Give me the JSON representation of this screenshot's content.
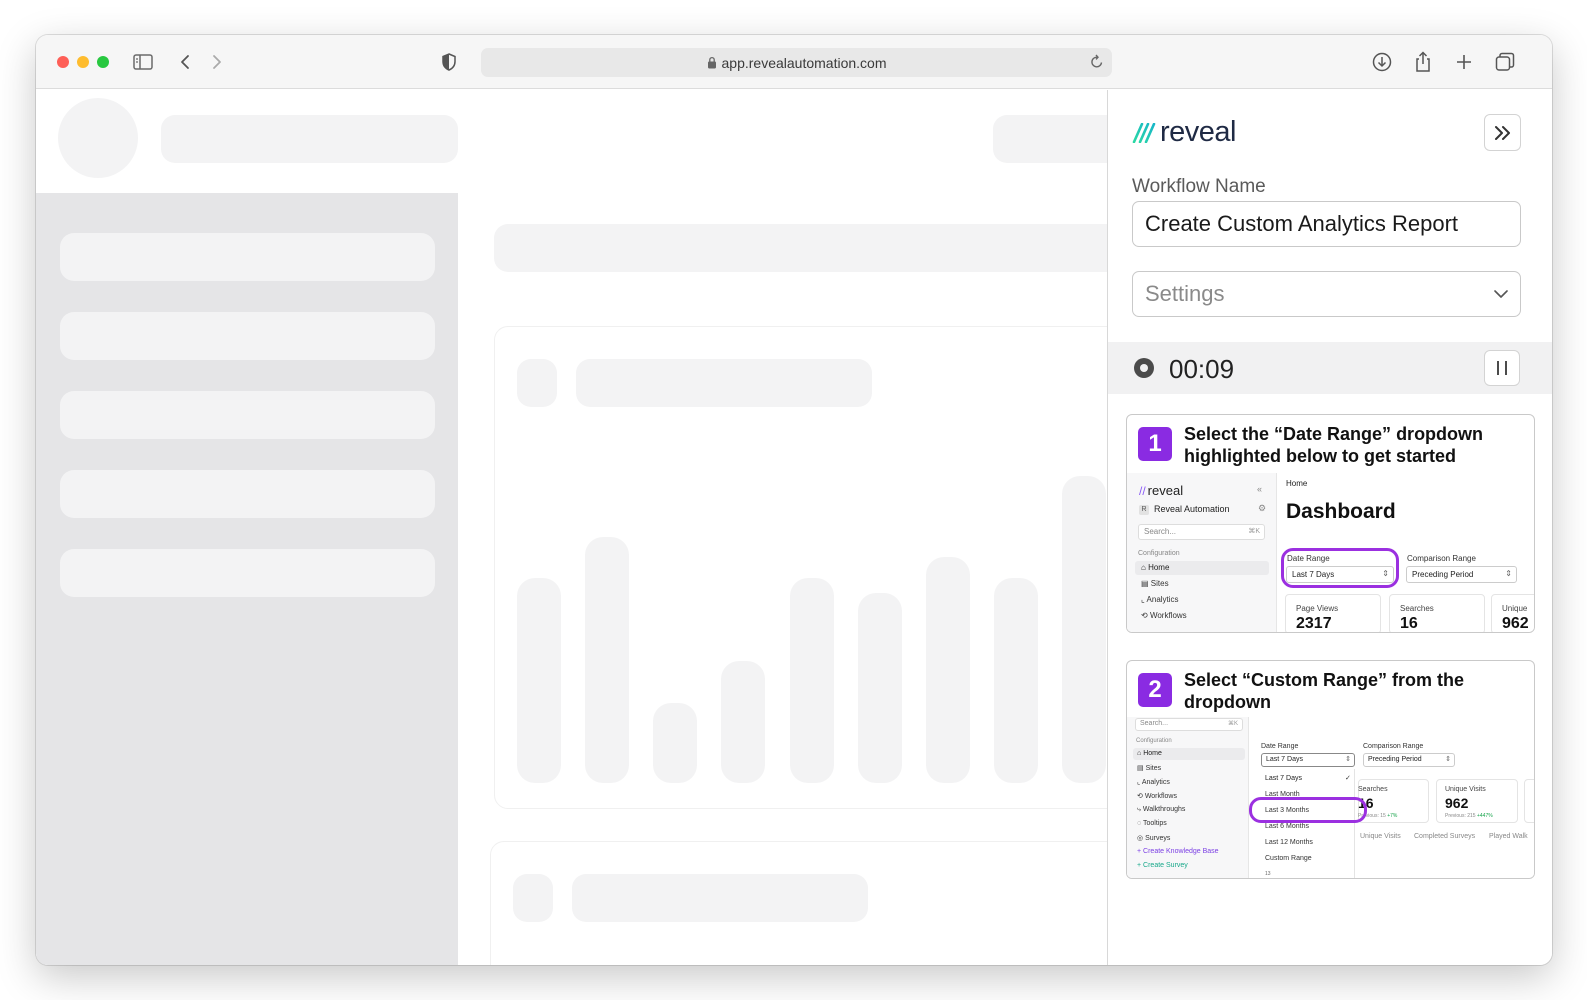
{
  "browser": {
    "url": "app.revealautomation.com"
  },
  "panel": {
    "brand": "reveal",
    "workflow_label": "Workflow Name",
    "workflow_name": "Create Custom Analytics Report",
    "settings_label": "Settings",
    "timer": "00:09",
    "steps": [
      {
        "number": "1",
        "title": "Select the “Date Range” dropdown highlighted below to get started",
        "shot": {
          "brand": "reveal",
          "org": "Reveal Automation",
          "org_initial": "R",
          "search_placeholder": "Search...",
          "search_shortcut": "⌘K",
          "section": "Configuration",
          "nav": [
            "Home",
            "Sites",
            "Analytics",
            "Workflows"
          ],
          "breadcrumb": "Home",
          "heading": "Dashboard",
          "date_range_label": "Date Range",
          "date_range_value": "Last 7 Days",
          "comparison_label": "Comparison Range",
          "comparison_value": "Preceding Period",
          "stats": [
            {
              "label": "Page Views",
              "value": "2317"
            },
            {
              "label": "Searches",
              "value": "16"
            },
            {
              "label": "Unique",
              "value": "962"
            }
          ]
        }
      },
      {
        "number": "2",
        "title": "Select “Custom Range” from the dropdown",
        "shot": {
          "search_placeholder": "Search...",
          "search_shortcut": "⌘K",
          "section": "Configuration",
          "nav": [
            "Home",
            "Sites",
            "Analytics",
            "Workflows",
            "Walkthroughs",
            "Tooltips",
            "Surveys"
          ],
          "create_kb": "Create Knowledge Base",
          "create_survey": "Create Survey",
          "date_range_label": "Date Range",
          "date_range_value": "Last 7 Days",
          "comparison_label": "Comparison Range",
          "comparison_value": "Preceding Period",
          "options": [
            "Last 7 Days",
            "Last Month",
            "Last 3 Months",
            "Last 6 Months",
            "Last 12 Months",
            "Custom Range"
          ],
          "searches_label": "Searches",
          "searches_value": "16",
          "searches_prev": "Previous: 15",
          "searches_delta": "+7%",
          "unique_label": "Unique Visits",
          "unique_value": "962",
          "unique_prev": "Previous: 215",
          "unique_delta": "+447%",
          "tabs": [
            "Unique Visits",
            "Completed Surveys",
            "Played Walk"
          ],
          "footer_mark": "13"
        }
      }
    ],
    "accent_color": "#8a2be2"
  }
}
